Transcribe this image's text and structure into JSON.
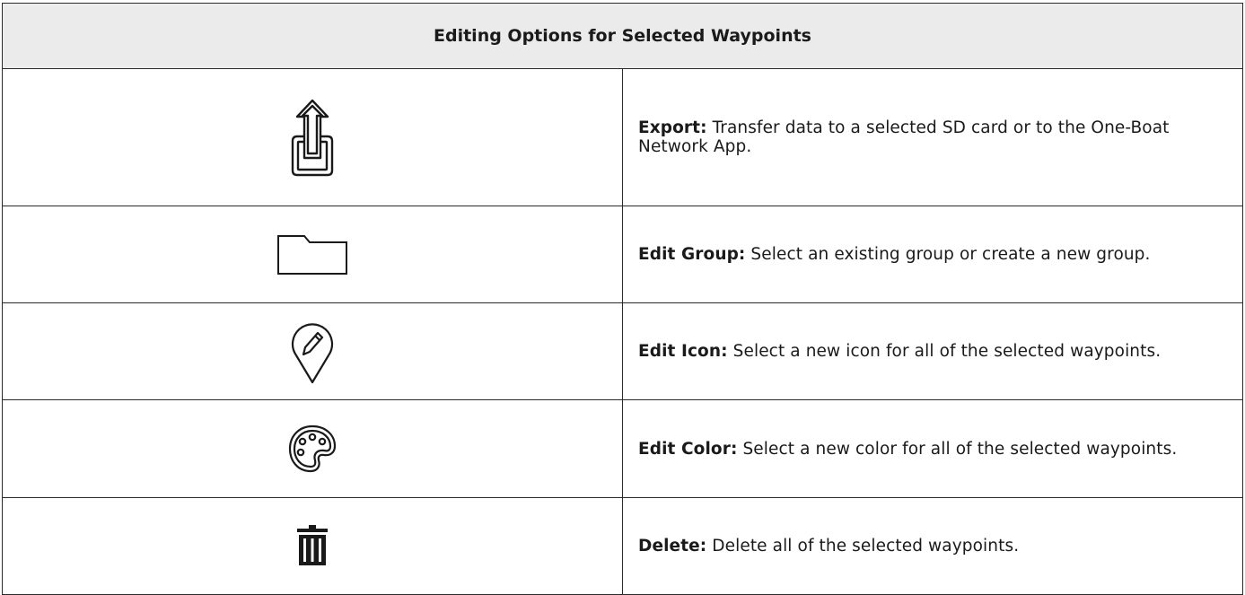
{
  "table": {
    "header": "Editing Options for Selected Waypoints",
    "rows": [
      {
        "icon": "export-icon",
        "term": "Export:",
        "description": "Transfer data to a selected SD card or to the One-Boat Network App."
      },
      {
        "icon": "folder-icon",
        "term": "Edit Group:",
        "description": "Select an existing group or create a new group."
      },
      {
        "icon": "edit-pin-icon",
        "term": "Edit Icon:",
        "description": "Select a new icon for all of the selected waypoints."
      },
      {
        "icon": "palette-icon",
        "term": "Edit Color:",
        "description": "Select a new color for all of the selected waypoints."
      },
      {
        "icon": "trash-icon",
        "term": "Delete:",
        "description": "Delete all of the selected waypoints."
      }
    ]
  }
}
